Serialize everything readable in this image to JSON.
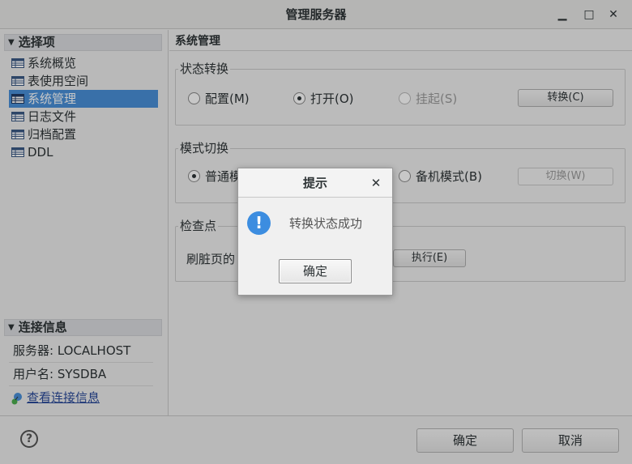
{
  "window": {
    "title": "管理服务器",
    "minimize_glyph": "▁",
    "maximize_glyph": "□",
    "close_glyph": "✕"
  },
  "sidebar": {
    "section_options": "选择项",
    "items": [
      {
        "label": "系统概览",
        "icon": "table-icon",
        "selected": false
      },
      {
        "label": "表使用空间",
        "icon": "table-icon",
        "selected": false
      },
      {
        "label": "系统管理",
        "icon": "table-icon",
        "selected": true
      },
      {
        "label": "日志文件",
        "icon": "table-icon",
        "selected": false
      },
      {
        "label": "归档配置",
        "icon": "table-icon",
        "selected": false
      },
      {
        "label": "DDL",
        "icon": "table-icon",
        "selected": false
      }
    ],
    "section_connection": "连接信息",
    "server_label": "服务器: LOCALHOST",
    "user_label": "用户名: SYSDBA",
    "view_link": "查看连接信息"
  },
  "main": {
    "title": "系统管理",
    "state_group": {
      "legend": "状态转换",
      "options": [
        {
          "label": "配置(M)",
          "checked": false,
          "disabled": false
        },
        {
          "label": "打开(O)",
          "checked": true,
          "disabled": false
        },
        {
          "label": "挂起(S)",
          "checked": false,
          "disabled": true
        }
      ],
      "button": "转换(C)"
    },
    "mode_group": {
      "legend": "模式切换",
      "options": [
        {
          "label": "普通模",
          "checked": true,
          "disabled": false
        },
        {
          "label": "备机模式(B)",
          "checked": false,
          "disabled": false
        }
      ],
      "button": "切换(W)"
    },
    "checkpoint_group": {
      "legend": "检查点",
      "label": "刷脏页的",
      "button": "执行(E)"
    }
  },
  "footer": {
    "help_glyph": "?",
    "ok": "确定",
    "cancel": "取消"
  },
  "dialog": {
    "title": "提示",
    "close_glyph": "✕",
    "icon_glyph": "!",
    "message": "转换状态成功",
    "ok": "确定"
  },
  "colors": {
    "selection": "#4a90d9",
    "info_icon": "#3c8de0"
  }
}
